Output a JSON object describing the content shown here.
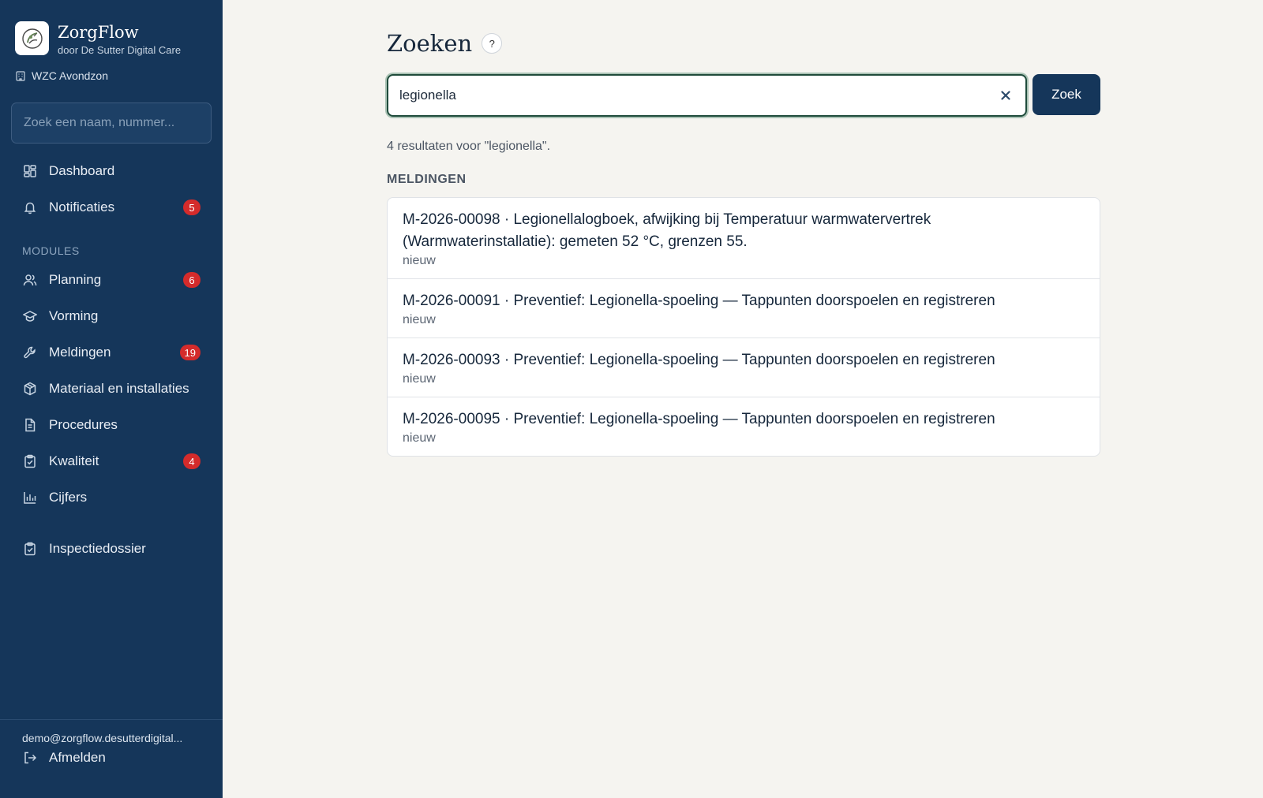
{
  "brand": {
    "name": "ZorgFlow",
    "subtitle": "door De Sutter Digital Care"
  },
  "org": {
    "name": "WZC Avondzon"
  },
  "sidebar_search": {
    "placeholder": "Zoek een naam, nummer..."
  },
  "nav": {
    "dashboard": {
      "label": "Dashboard"
    },
    "notificaties": {
      "label": "Notificaties",
      "badge": "5"
    },
    "modules_label": "MODULES",
    "planning": {
      "label": "Planning",
      "badge": "6"
    },
    "vorming": {
      "label": "Vorming"
    },
    "meldingen": {
      "label": "Meldingen",
      "badge": "19"
    },
    "materiaal": {
      "label": "Materiaal en installaties"
    },
    "procedures": {
      "label": "Procedures"
    },
    "kwaliteit": {
      "label": "Kwaliteit",
      "badge": "4"
    },
    "cijfers": {
      "label": "Cijfers"
    },
    "inspectiedossier": {
      "label": "Inspectiedossier"
    }
  },
  "user": {
    "email": "demo@zorgflow.desutterdigital...",
    "logout_label": "Afmelden"
  },
  "main": {
    "title": "Zoeken",
    "help_label": "?",
    "search": {
      "value": "legionella",
      "button_label": "Zoek"
    },
    "result_count": "4 resultaten voor \"legionella\".",
    "section_label": "MELDINGEN",
    "results": [
      {
        "title": "M-2026-00098 · Legionellalogboek, afwijking bij Temperatuur warmwatervertrek (Warmwaterinstallatie): gemeten 52 °C, grenzen 55.",
        "status": "nieuw"
      },
      {
        "title": "M-2026-00091 · Preventief: Legionella-spoeling — Tappunten doorspoelen en registreren",
        "status": "nieuw"
      },
      {
        "title": "M-2026-00093 · Preventief: Legionella-spoeling — Tappunten doorspoelen en registreren",
        "status": "nieuw"
      },
      {
        "title": "M-2026-00095 · Preventief: Legionella-spoeling — Tappunten doorspoelen en registreren",
        "status": "nieuw"
      }
    ]
  },
  "colors": {
    "sidebar_bg": "#15365a",
    "badge": "#d42b2b",
    "primary_button": "#15365a",
    "page_bg": "#f5f4f0",
    "focus_ring": "#1f4b3b"
  }
}
